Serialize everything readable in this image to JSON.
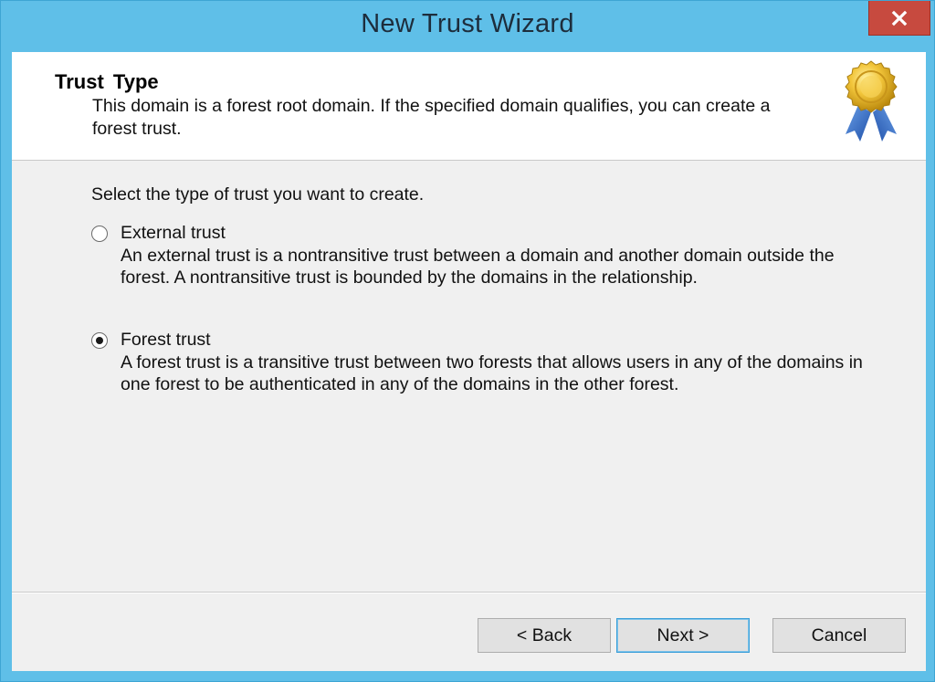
{
  "window": {
    "title": "New Trust Wizard",
    "close_glyph": "×"
  },
  "header": {
    "title": "Trust Type",
    "description": "This domain is a forest root domain. If the specified domain qualifies, you can create a forest trust.",
    "icon": "award-ribbon-icon"
  },
  "body": {
    "prompt": "Select the type of trust you want to create.",
    "options": [
      {
        "label": "External trust",
        "description": "An external trust is a nontransitive trust between a domain and another domain outside the forest. A nontransitive trust is bounded by the domains in the relationship.",
        "selected": false
      },
      {
        "label": "Forest trust",
        "description": "A forest trust is a transitive trust between two forests that allows users in any of the domains in one forest to be authenticated in any of the domains in the other forest.",
        "selected": true
      }
    ]
  },
  "footer": {
    "back_label": "< Back",
    "next_label": "Next >",
    "cancel_label": "Cancel"
  },
  "colors": {
    "titlebar": "#5fbfe8",
    "close_button": "#c74a3f",
    "client_bg": "#f0f0f0",
    "header_bg": "#ffffff",
    "default_button_border": "#3c9fd8"
  }
}
